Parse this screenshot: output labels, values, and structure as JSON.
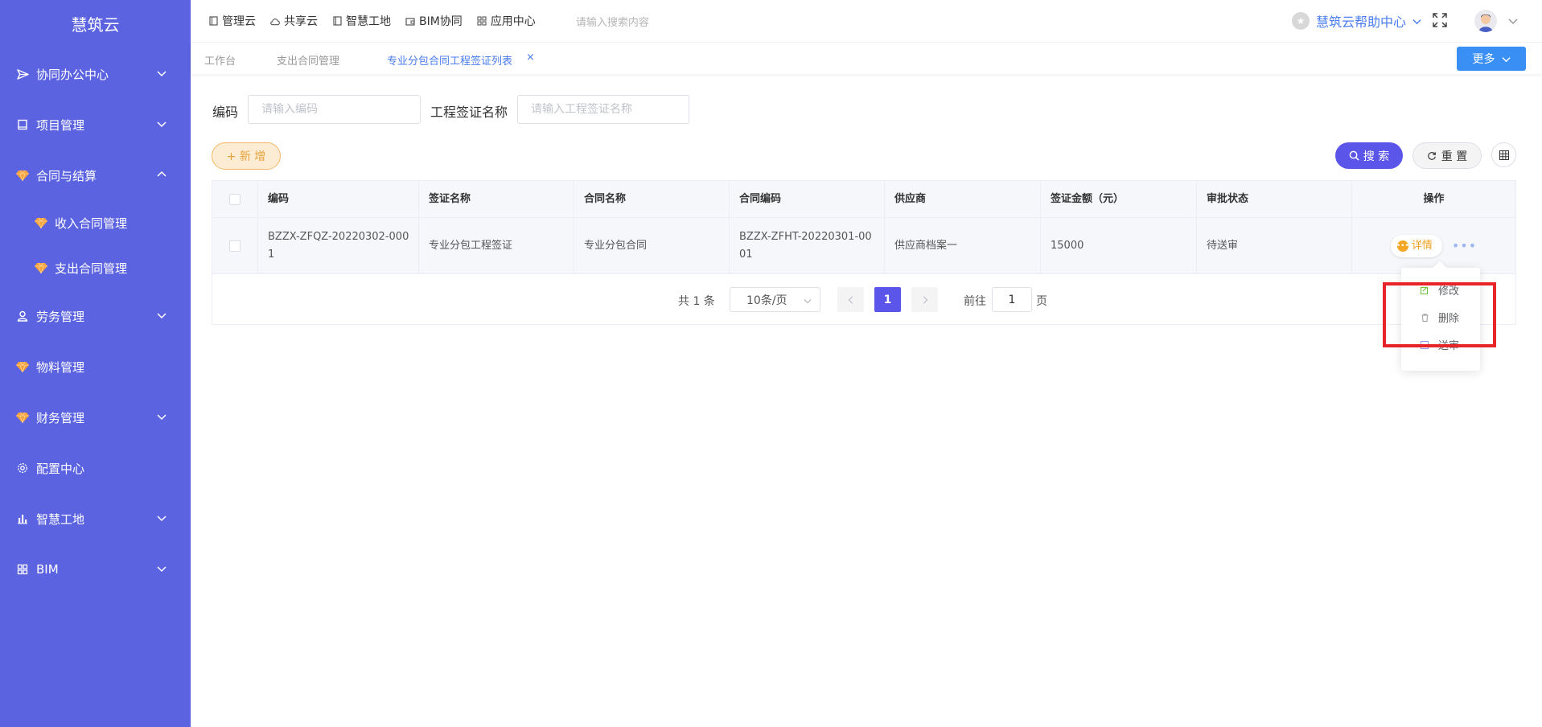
{
  "brand": "慧筑云",
  "sidebar": {
    "items": [
      {
        "label": "协同办公中心"
      },
      {
        "label": "项目管理"
      },
      {
        "label": "合同与结算"
      },
      {
        "label": "收入合同管理"
      },
      {
        "label": "支出合同管理"
      },
      {
        "label": "劳务管理"
      },
      {
        "label": "物料管理"
      },
      {
        "label": "财务管理"
      },
      {
        "label": "配置中心"
      },
      {
        "label": "智慧工地"
      },
      {
        "label": "BIM"
      }
    ]
  },
  "topbar": {
    "nav": [
      "管理云",
      "共享云",
      "智慧工地",
      "BIM协同",
      "应用中心"
    ],
    "search_placeholder": "请输入搜索内容",
    "help_label": "慧筑云帮助中心"
  },
  "tabs": {
    "items": [
      "工作台",
      "支出合同管理",
      "专业分包合同工程签证列表"
    ],
    "close": "×",
    "more_label": "更多"
  },
  "filters": {
    "code_label": "编码",
    "code_placeholder": "请输入编码",
    "name_label": "工程签证名称",
    "name_placeholder": "请输入工程签证名称"
  },
  "toolbar": {
    "add_label": "+ 新 增",
    "search_label": "搜 索",
    "reset_label": "重 置"
  },
  "table": {
    "headers": [
      "编码",
      "签证名称",
      "合同名称",
      "合同编码",
      "供应商",
      "签证金额（元）",
      "审批状态",
      "操作"
    ],
    "rows": [
      {
        "code_l1": "BZZX-ZFQZ-20220302-000",
        "code_l2": "1",
        "name": "专业分包工程签证",
        "contract_name": "专业分包合同",
        "contract_code_l1": "BZZX-ZFHT-20220301-00",
        "contract_code_l2": "01",
        "supplier": "供应商档案一",
        "amount": "15000",
        "status": "待送审",
        "detail_label": "详情",
        "more": "•••"
      }
    ]
  },
  "pagination": {
    "total": "共 1 条",
    "page_size": "10条/页",
    "current": "1",
    "goto_prefix": "前往",
    "goto_value": "1",
    "goto_suffix": "页"
  },
  "dropdown": {
    "items": [
      "修改",
      "删除",
      "送审"
    ]
  },
  "colors": {
    "sidebar_bg": "#5b63e0",
    "primary": "#5b55ea",
    "link_blue": "#4a7cf0",
    "warning": "#f0a020",
    "highlight_red": "#e8242b"
  }
}
